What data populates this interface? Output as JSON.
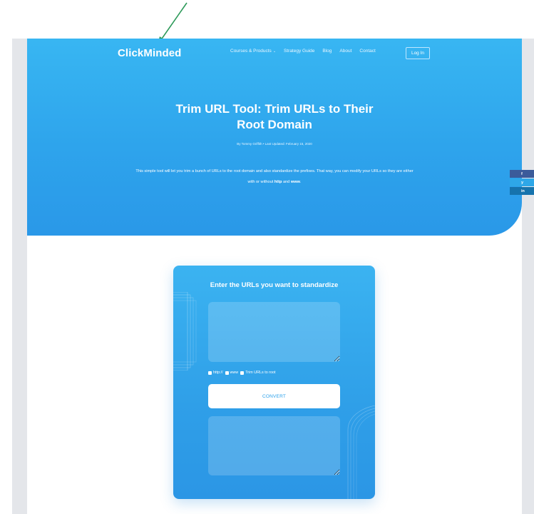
{
  "header": {
    "logo": "ClickMinded",
    "nav": [
      {
        "label": "Courses & Products",
        "chevron": "⌄"
      },
      {
        "label": "Strategy Guide"
      },
      {
        "label": "Blog"
      },
      {
        "label": "About"
      },
      {
        "label": "Contact"
      }
    ],
    "login_label": "Log In"
  },
  "hero": {
    "title_line1": "Trim URL Tool: Trim URLs to Their",
    "title_line2": "Root Domain",
    "byline": "By Tommy Griffith • Last Updated: February 15, 2020",
    "intro_part1": "This simple tool will let you trim a bunch of URLs to the root domain and also standardize the prefixes. That way, you can modify your URLs so they are either with or without ",
    "intro_bold1": "http",
    "intro_part2": " and ",
    "intro_bold2": "www",
    "intro_part3": "."
  },
  "tool": {
    "title": "Enter the URLs you want to standardize",
    "options": [
      "http://",
      "www",
      "Trim URLs to root"
    ],
    "convert_label": "CONVERT"
  },
  "share": {
    "facebook": "f",
    "twitter": "y",
    "linkedin": "in"
  },
  "colors": {
    "brand_blue": "#2ea4ec",
    "facebook": "#3b5b9a",
    "twitter": "#2ea7e8",
    "linkedin": "#1673ad",
    "annotation_arrow": "#2e9a5a"
  },
  "icons": {
    "annotation": "arrow-icon",
    "nav_dropdown": "chevron-down-icon"
  }
}
